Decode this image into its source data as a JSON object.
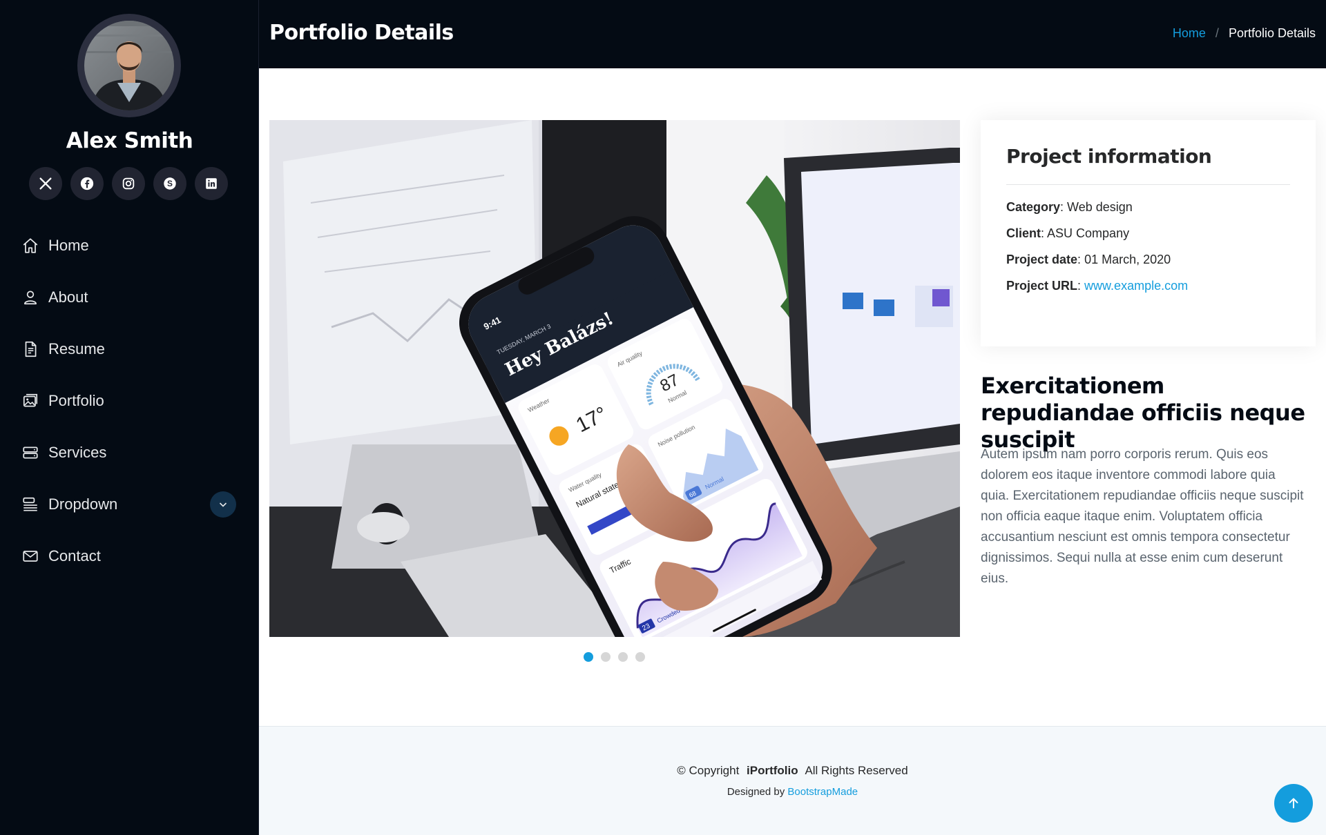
{
  "profile": {
    "name": "Alex Smith"
  },
  "socials": [
    {
      "icon": "x-twitter-icon"
    },
    {
      "icon": "facebook-icon"
    },
    {
      "icon": "instagram-icon"
    },
    {
      "icon": "skype-icon"
    },
    {
      "icon": "linkedin-icon"
    }
  ],
  "nav": {
    "items": [
      {
        "label": "Home",
        "icon": "house-icon"
      },
      {
        "label": "About",
        "icon": "person-icon"
      },
      {
        "label": "Resume",
        "icon": "file-text-icon"
      },
      {
        "label": "Portfolio",
        "icon": "images-icon"
      },
      {
        "label": "Services",
        "icon": "hdd-stack-icon"
      },
      {
        "label": "Dropdown",
        "icon": "menu-button-icon"
      },
      {
        "label": "Contact",
        "icon": "envelope-icon"
      }
    ]
  },
  "header": {
    "title": "Portfolio Details",
    "breadcrumb": {
      "home": "Home",
      "separator": "/",
      "current": "Portfolio Details"
    }
  },
  "project_info": {
    "title": "Project information",
    "category_label": "Category",
    "category_value": "Web design",
    "client_label": "Client",
    "client_value": "ASU Company",
    "date_label": "Project date",
    "date_value": "01 March, 2020",
    "url_label": "Project URL",
    "url_value": "www.example.com"
  },
  "phone_screen": {
    "time": "9:41",
    "date": "TUESDAY, MARCH 3",
    "greeting": "Hey Balázs!",
    "weather_label": "Weather",
    "weather_temp": "17°",
    "air_label": "Air quality",
    "air_value": "87",
    "air_status": "Normal",
    "water_label": "Water quality",
    "water_status": "Natural state",
    "noise_label": "Noise pollution",
    "noise_value": "68",
    "noise_status": "Normal",
    "traffic_label": "Traffic",
    "traffic_value": "23",
    "traffic_status": "Crowded"
  },
  "slider": {
    "count": 4,
    "active": 0
  },
  "description": {
    "title": "Exercitationem repudiandae officiis neque suscipit",
    "text": "Autem ipsum nam porro corporis rerum. Quis eos dolorem eos itaque inventore commodi labore quia quia. Exercitationem repudiandae officiis neque suscipit non officia eaque itaque enim. Voluptatem officia accusantium nesciunt est omnis tempora consectetur dignissimos. Sequi nulla at esse enim cum deserunt eius."
  },
  "footer": {
    "copyright_prefix": "© Copyright",
    "brand": "iPortfolio",
    "rights": "All Rights Reserved",
    "designed_by": "Designed by",
    "designer": "BootstrapMade"
  },
  "colors": {
    "accent": "#149ddd",
    "sidebar_bg": "#040b14"
  }
}
